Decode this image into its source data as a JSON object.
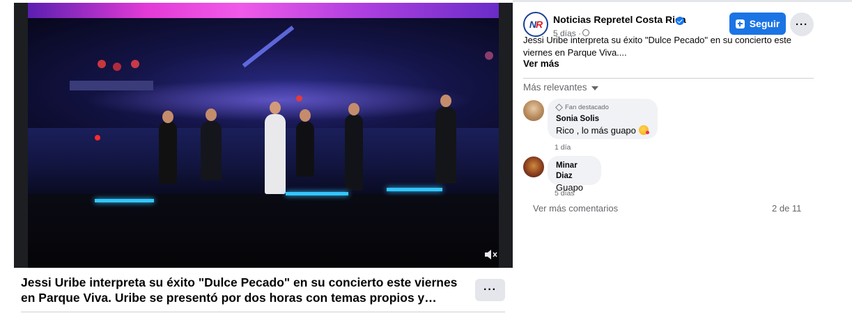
{
  "post": {
    "title": "Jessi Uribe interpreta su éxito \"Dulce Pecado\" en su concierto este viernes en Parque Viva. Uribe se presentó por dos horas con temas propios y…",
    "options_icon": "more-horizontal-icon"
  },
  "video": {
    "muted": true,
    "mute_icon": "volume-muted-icon"
  },
  "page": {
    "avatar_text_a": "N",
    "avatar_text_b": "R",
    "name": "Noticias Repretel Costa Rica",
    "verified": true,
    "time": "5 días ·",
    "follow_label": "Seguir",
    "description": "Jessi Uribe interpreta su éxito \"Dulce Pecado\" en su concierto este viernes en Parque Viva....",
    "see_more": "Ver más",
    "brand_color": "#1b74e4"
  },
  "comments": {
    "sort_label": "Más relevantes",
    "items": [
      {
        "badge": "Fan destacado",
        "author": "Sonia Solis",
        "text": "Rico , lo más guapo",
        "time": "1 día"
      },
      {
        "badge": "",
        "author": "Minar Diaz",
        "text": "Guapo",
        "time": "5 días"
      }
    ],
    "more_label": "Ver más comentarios",
    "count": "2 de 11"
  }
}
